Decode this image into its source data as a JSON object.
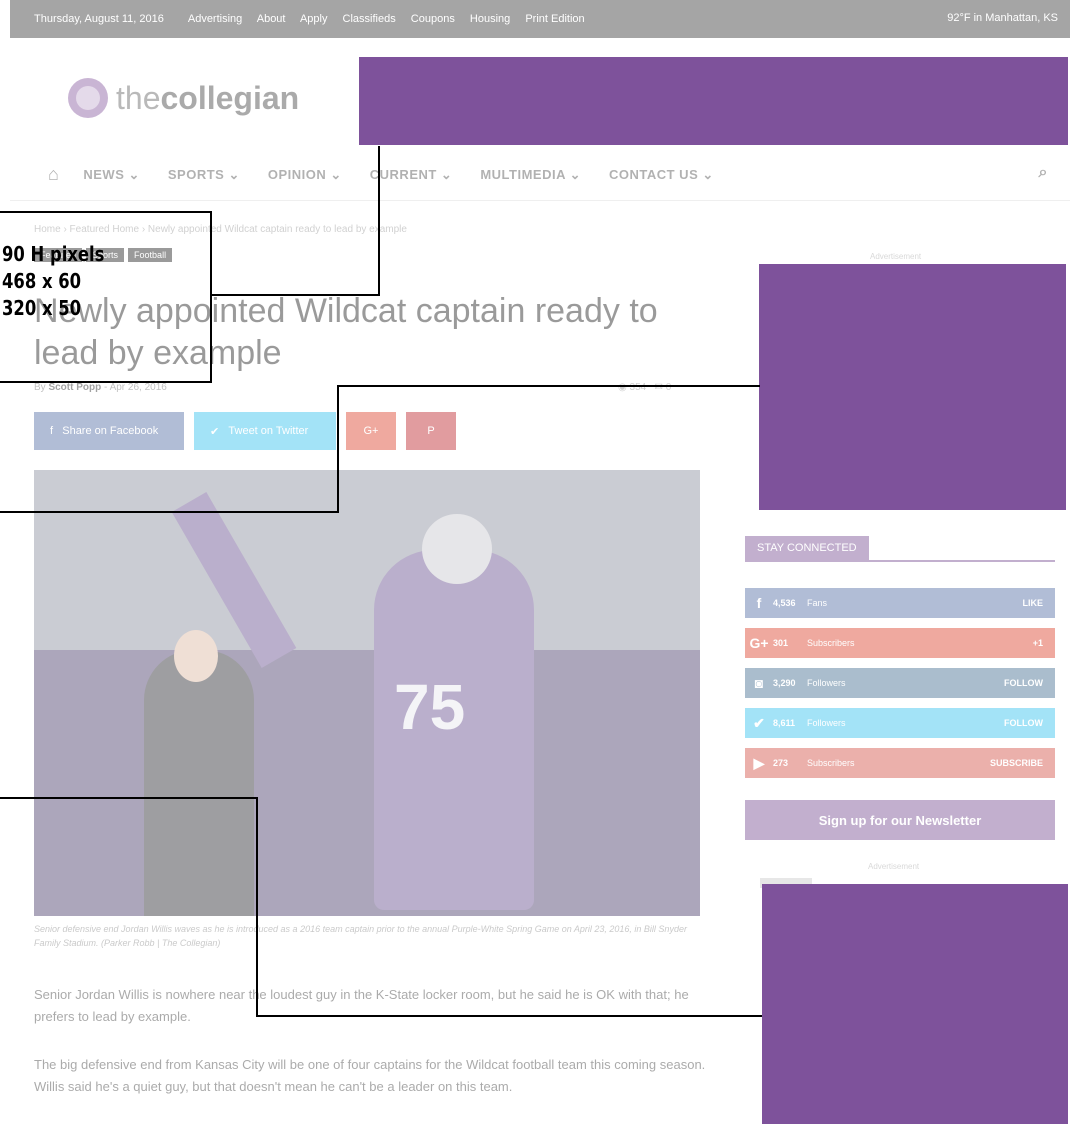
{
  "topbar": {
    "date": "Thursday, August 11, 2016",
    "links": [
      "Advertising",
      "About",
      "Apply",
      "Classifieds",
      "Coupons",
      "Housing",
      "Print Edition"
    ],
    "weather": "92°F in Manhattan, KS"
  },
  "logo": {
    "prefix": "the",
    "name": "collegian"
  },
  "nav": {
    "items": [
      "NEWS ⌄",
      "SPORTS ⌄",
      "OPINION ⌄",
      "CURRENT ⌄",
      "MULTIMEDIA ⌄",
      "CONTACT US ⌄"
    ]
  },
  "breadcrumb": "Home › Featured Home › Newly appointed Wildcat captain ready to lead by example",
  "tags": [
    "Featured",
    "Sports",
    "Football"
  ],
  "article": {
    "headline": "Newly appointed Wildcat captain ready to lead by example",
    "by": "By",
    "author": "Scott Popp",
    "date": "Apr 26, 2016",
    "views": "354",
    "comments": "0",
    "photo_number": "75",
    "caption": "Senior defensive end Jordan Willis waves as he is introduced as a 2016 team captain prior to the annual Purple-White Spring Game on April 23, 2016, in Bill Snyder Family Stadium. (Parker Robb | The Collegian)",
    "paragraphs": [
      "Senior Jordan Willis is nowhere near the loudest guy in the K-State locker room, but he said he is OK with that; he prefers to lead by example.",
      "The big defensive end from Kansas City will be one of four captains for the Wildcat football team this coming season. Willis said he's a quiet guy, but that doesn't mean he can't be a leader on this team."
    ]
  },
  "share": {
    "facebook": "Share on Facebook",
    "twitter": "Tweet on Twitter",
    "googleplus": "G+",
    "pinterest": "P"
  },
  "sidebar": {
    "ad_label": "Advertisement",
    "stay_connected": "STAY CONNECTED",
    "social": [
      {
        "icon": "f",
        "count": "4,536",
        "label": "Fans",
        "action": "LIKE"
      },
      {
        "icon": "G+",
        "count": "301",
        "label": "Subscribers",
        "action": "+1"
      },
      {
        "icon": "◙",
        "count": "3,290",
        "label": "Followers",
        "action": "FOLLOW"
      },
      {
        "icon": "✔",
        "count": "8,611",
        "label": "Followers",
        "action": "FOLLOW"
      },
      {
        "icon": "▶",
        "count": "273",
        "label": "Subscribers",
        "action": "SUBSCRIBE"
      }
    ],
    "newsletter": "Sign up for our Newsletter"
  },
  "overlay": {
    "sizes": [
      "90 H pixels",
      "468 x 60",
      "320 x 50"
    ],
    "colors": {
      "ad_block": "#7e529b",
      "lines": "#000000"
    }
  }
}
